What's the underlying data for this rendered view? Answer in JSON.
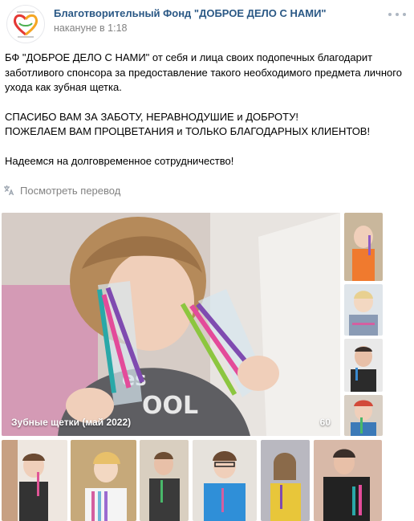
{
  "post": {
    "author": "Благотворительный Фонд \"ДОБРОЕ ДЕЛО С НАМИ\"",
    "time": "накануне в 1:18",
    "text": [
      "БФ \"ДОБРОЕ ДЕЛО С НАМИ\" от себя и лица своих подопечных благодарит заботливого спонсора за предоставление такого необходимого предмета личного ухода как зубная щетка.",
      "СПАСИБО ВАМ ЗА ЗАБОТУ, НЕРАВНОДУШИЕ и ДОБРОТУ!",
      "ПОЖЕЛАЕМ ВАМ ПРОЦВЕТАНИЯ и ТОЛЬКО БЛАГОДАРНЫХ КЛИЕНТОВ!",
      "Надеемся на долговременное сотрудничество!"
    ],
    "translate_label": "Посмотреть перевод"
  },
  "album": {
    "title": "Зубные щетки (май 2022)",
    "count": "60"
  },
  "icons": {
    "avatar": "charity-heart-logo-icon",
    "more": "more-dots-icon",
    "translate": "translate-icon"
  },
  "colors": {
    "link": "#2a5885",
    "muted": "#828282",
    "heart_red": "#e53935",
    "heart_orange": "#f5a623",
    "heart_green": "#4caf50"
  }
}
